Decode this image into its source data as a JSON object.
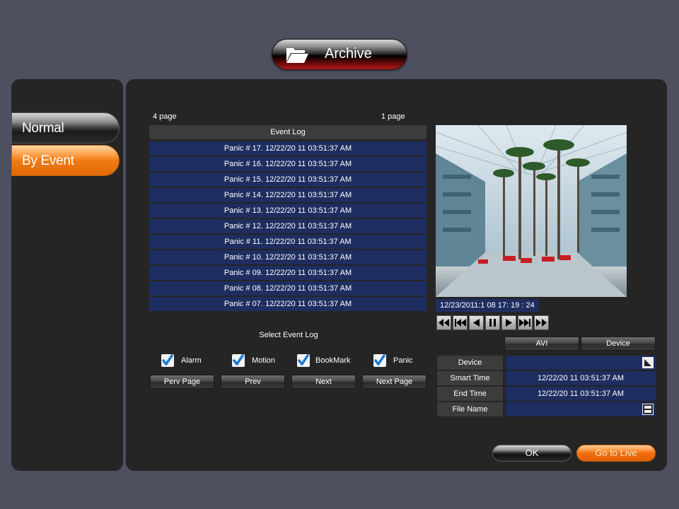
{
  "header": {
    "title": "Archive",
    "icon": "folder-open-icon"
  },
  "sidebar": {
    "items": [
      {
        "label": "Normal",
        "active": false
      },
      {
        "label": "By Event",
        "active": true
      }
    ]
  },
  "event_log": {
    "page_left": "4 page",
    "page_right": "1 page",
    "header": "Event Log",
    "rows": [
      "Panic # 17. 12/22/20 11 03:51:37 AM",
      "Panic # 16. 12/22/20 11 03:51:37 AM",
      "Panic # 15. 12/22/20 11 03:51:37 AM",
      "Panic # 14. 12/22/20 11 03:51:37 AM",
      "Panic # 13. 12/22/20 11 03:51:37 AM",
      "Panic # 12. 12/22/20 11 03:51:37 AM",
      "Panic # 11. 12/22/20 11 03:51:37 AM",
      "Panic # 10. 12/22/20 11 03:51:37 AM",
      "Panic # 09. 12/22/20 11 03:51:37 AM",
      "Panic # 08. 12/22/20 11 03:51:37 AM",
      "Panic # 07. 12/22/20 11 03:51:37 AM"
    ]
  },
  "filters": {
    "title": "Select Event Log",
    "options": [
      {
        "label": "Alarm",
        "checked": true
      },
      {
        "label": "Motion",
        "checked": true
      },
      {
        "label": "BookMark",
        "checked": true
      },
      {
        "label": "Panic",
        "checked": true
      }
    ]
  },
  "paging": {
    "prev_page": "Perv Page",
    "prev": "Prev",
    "next": "Next",
    "next_page": "Next Page"
  },
  "preview": {
    "timestamp": "12/23/2011:1 08 17: 19 : 24",
    "controls": [
      "fast-rewind-icon",
      "skip-start-icon",
      "step-back-icon",
      "pause-icon",
      "play-icon",
      "skip-end-icon",
      "fast-forward-icon"
    ]
  },
  "export": {
    "avi_label": "AVI",
    "device_tab_label": "Device",
    "device_label": "Device",
    "device_value": "",
    "start_label": "Smart Time",
    "start_value": "12/22/20 11 03:51:37 AM",
    "end_label": "End Time",
    "end_value": "12/22/20 11 03:51:37 AM",
    "filename_label": "File Name",
    "filename_value": ""
  },
  "actions": {
    "ok": "OK",
    "live": "Go to Live"
  },
  "colors": {
    "background": "#4e4f5f",
    "panel": "#252525",
    "row_blue": "#1e2e60",
    "accent_orange": "#f07a12",
    "checkbox_blue": "#1a7ad6"
  }
}
